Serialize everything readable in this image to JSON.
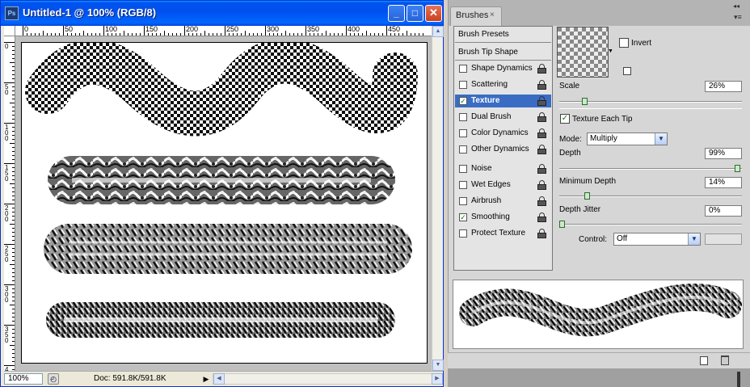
{
  "document": {
    "title": "Untitled-1 @ 100% (RGB/8)",
    "app_icon_text": "Ps",
    "zoom": "100%",
    "doc_info": "Doc: 591.8K/591.8K",
    "ruler_h": [
      "0",
      "50",
      "100",
      "150",
      "200",
      "250",
      "300",
      "350",
      "400",
      "450"
    ],
    "ruler_v": [
      "0",
      "50",
      "100",
      "150",
      "200",
      "250",
      "300",
      "350",
      "4"
    ]
  },
  "panel": {
    "tab_label": "Brushes",
    "tab_close": "×",
    "collapse": "◂◂",
    "menu": "▾≡",
    "brush_presets": "Brush Presets",
    "brush_tip_shape": "Brush Tip Shape",
    "options": [
      {
        "label": "Shape Dynamics",
        "checked": false,
        "selected": false
      },
      {
        "label": "Scattering",
        "checked": false,
        "selected": false
      },
      {
        "label": "Texture",
        "checked": true,
        "selected": true
      },
      {
        "label": "Dual Brush",
        "checked": false,
        "selected": false
      },
      {
        "label": "Color Dynamics",
        "checked": false,
        "selected": false
      },
      {
        "label": "Other Dynamics",
        "checked": false,
        "selected": false
      },
      {
        "label": "Noise",
        "checked": false,
        "selected": false
      },
      {
        "label": "Wet Edges",
        "checked": false,
        "selected": false
      },
      {
        "label": "Airbrush",
        "checked": false,
        "selected": false
      },
      {
        "label": "Smoothing",
        "checked": true,
        "selected": false
      },
      {
        "label": "Protect Texture",
        "checked": false,
        "selected": false
      }
    ],
    "texture": {
      "invert_label": "Invert",
      "invert_checked": false,
      "scale_label": "Scale",
      "scale_value": "26%",
      "scale_level": 0.13,
      "texture_each_tip_label": "Texture Each Tip",
      "texture_each_tip_checked": true,
      "mode_label": "Mode:",
      "mode_value": "Multiply",
      "depth_label": "Depth",
      "depth_value": "99%",
      "depth_level": 0.99,
      "min_depth_label": "Minimum Depth",
      "min_depth_value": "14%",
      "min_depth_level": 0.14,
      "depth_jitter_label": "Depth Jitter",
      "depth_jitter_value": "0%",
      "depth_jitter_level": 0.0,
      "control_label": "Control:",
      "control_value": "Off"
    }
  },
  "colors": {
    "title_blue": "#0054e3",
    "selection_blue": "#3a6cc4",
    "check_green": "#0a7a0a"
  }
}
